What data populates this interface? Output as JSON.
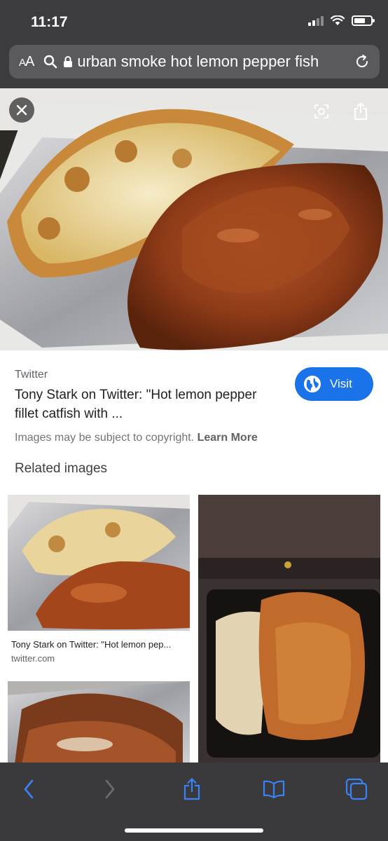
{
  "status_bar": {
    "time": "11:17"
  },
  "browser": {
    "text_size_label_small": "A",
    "text_size_label_large": "A",
    "url": "urban smoke hot lemon pepper fish"
  },
  "hero": {
    "close_icon": "close-icon",
    "lens_icon": "lens-icon",
    "share_icon": "share-icon"
  },
  "result": {
    "source": "Twitter",
    "title": "Tony Stark on Twitter: \"Hot lemon pepper fillet catfish with ...",
    "visit_label": "Visit",
    "copyright_text": "Images may be subject to copyright.",
    "learn_more": "Learn More"
  },
  "related": {
    "heading": "Related images",
    "items": [
      {
        "caption": "Tony Stark on Twitter: \"Hot lemon pep...",
        "domain": "twitter.com"
      },
      {
        "caption": "",
        "domain": ""
      },
      {
        "caption": "",
        "domain": ""
      }
    ]
  },
  "toolbar": {
    "back_icon": "back-icon",
    "forward_icon": "forward-icon",
    "share_icon": "share-icon",
    "bookmarks_icon": "bookmarks-icon",
    "tabs_icon": "tabs-icon"
  },
  "colors": {
    "accent": "#1a73e8",
    "toolbar_icon": "#3b82f6",
    "chrome": "#3c3c3e"
  }
}
